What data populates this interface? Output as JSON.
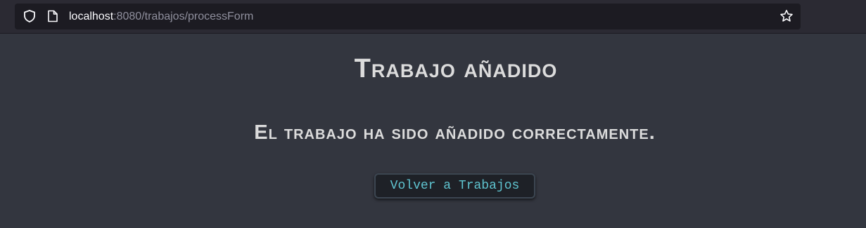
{
  "browser": {
    "url_host": "localhost",
    "url_path": ":8080/trabajos/processForm",
    "icons": {
      "security": "shield-icon",
      "page": "page-icon",
      "bookmark": "star-icon"
    }
  },
  "page": {
    "title": "Trabajo añadido",
    "message": "El trabajo ha sido añadido correctamente.",
    "back_button_label": "Volver a Trabajos"
  },
  "colors": {
    "background": "#33363f",
    "text": "#dcdcdc",
    "button_text": "#5fc4d0",
    "button_background": "#1e2127"
  }
}
